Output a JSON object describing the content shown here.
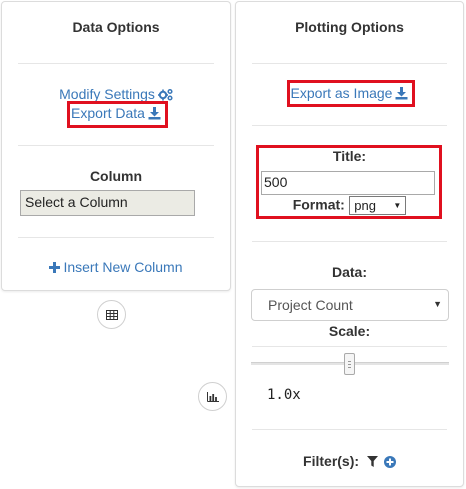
{
  "data_options": {
    "title": "Data Options",
    "modify_settings": "Modify Settings",
    "export_data": "Export Data",
    "column_label": "Column",
    "column_select_value": "Select a Column",
    "insert_new_column": "Insert New Column"
  },
  "plotting_options": {
    "title": "Plotting Options",
    "export_image": "Export as Image",
    "title_label": "Title:",
    "title_value": "500",
    "format_label": "Format:",
    "format_value": "png",
    "data_label": "Data:",
    "data_value": "Project Count",
    "scale_label": "Scale:",
    "scale_value": "1.0x",
    "filters_label": "Filter(s):"
  },
  "colors": {
    "link": "#3a78b9",
    "highlight": "#e0101f"
  },
  "icons": {
    "settings": "gears-icon",
    "download": "download-icon",
    "plus": "plus-icon",
    "table": "table-icon",
    "chart": "bar-chart-icon",
    "filter": "filter-icon",
    "add_circle": "plus-circle-icon"
  }
}
